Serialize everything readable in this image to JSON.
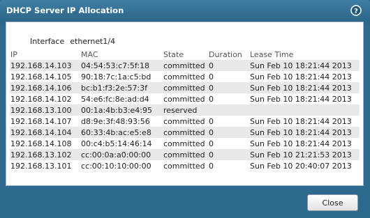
{
  "dialog": {
    "title": "DHCP Server IP Allocation",
    "help_icon": "question-circle-icon",
    "interface_label": "Interface",
    "interface_value": "ethernet1/4"
  },
  "table": {
    "headers": [
      "IP",
      "MAC",
      "State",
      "Duration",
      "Lease Time"
    ],
    "rows": [
      [
        "192.168.14.103",
        "04:54:53:c7:5f:18",
        "committed",
        "0",
        "Sun Feb 10 18:21:44 2013"
      ],
      [
        "192.168.14.105",
        "90:18:7c:1a:c5:bd",
        "committed",
        "0",
        "Sun Feb 10 18:21:44 2013"
      ],
      [
        "192.168.14.106",
        "bc:b1:f3:2e:57:3f",
        "committed",
        "0",
        "Sun Feb 10 18:21:44 2013"
      ],
      [
        "192.168.14.102",
        "54:e6:fc:8e:ad:d4",
        "committed",
        "0",
        "Sun Feb 10 18:21:44 2013"
      ],
      [
        "192.168.13.100",
        "00:1a:4b:b3:e4:95",
        "reserved",
        "",
        ""
      ],
      [
        "192.168.14.107",
        "d8:9e:3f:48:93:56",
        "committed",
        "0",
        "Sun Feb 10 18:21:44 2013"
      ],
      [
        "192.168.14.104",
        "60:33:4b:ac:e5:e8",
        "committed",
        "0",
        "Sun Feb 10 18:21:44 2013"
      ],
      [
        "192.168.14.108",
        "00:c4:b5:14:46:14",
        "committed",
        "0",
        "Sun Feb 10 18:21:44 2013"
      ],
      [
        "192.168.13.102",
        "cc:00:0a:a0:00:00",
        "committed",
        "0",
        "Sun Feb 10 21:21:53 2013"
      ],
      [
        "192.168.13.101",
        "cc:00:10:10:00:00",
        "committed",
        "0",
        "Sun Feb 10 20:40:07 2013"
      ]
    ]
  },
  "footer": {
    "close_label": "Close"
  }
}
